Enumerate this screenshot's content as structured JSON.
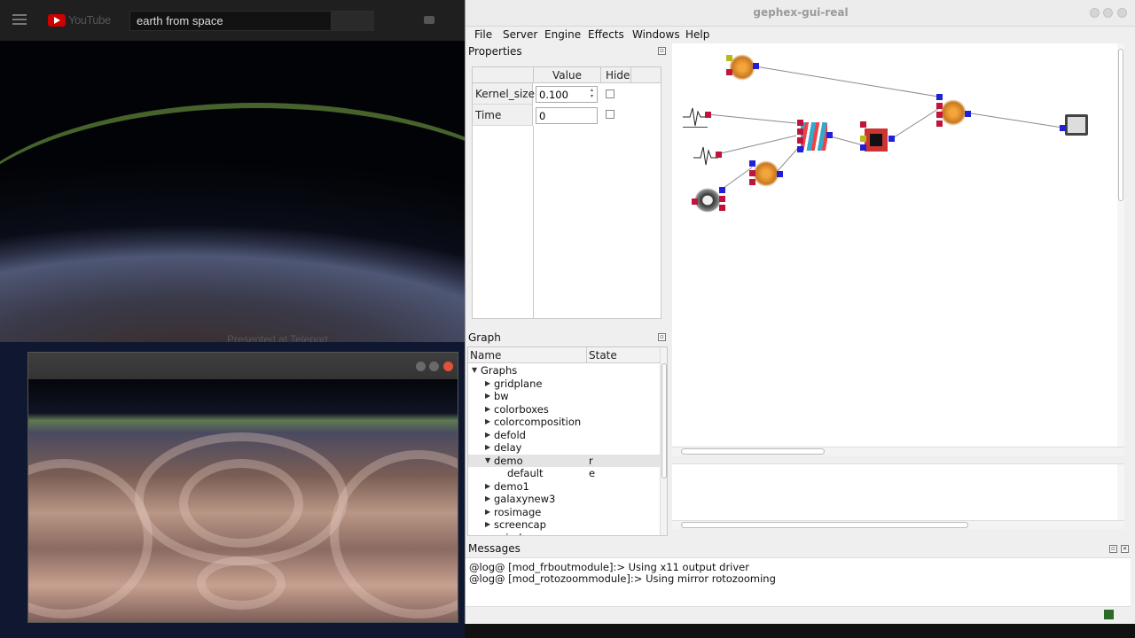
{
  "youtube": {
    "logo_text": "YouTube",
    "search_value": "earth from space",
    "caption": "Presented at Teleport"
  },
  "gephex": {
    "window_title": "gephex-gui-real",
    "menu": [
      "File",
      "Server",
      "Engine",
      "Effects",
      "Windows",
      "Help"
    ],
    "properties": {
      "title": "Properties",
      "col_value": "Value",
      "col_hide": "Hide",
      "rows": [
        {
          "name": "Kernel_size",
          "value": "0.100"
        },
        {
          "name": "Time",
          "value": "0"
        }
      ]
    },
    "graph": {
      "title": "Graph",
      "col_name": "Name",
      "col_state": "State",
      "root": "Graphs",
      "items": [
        {
          "label": "gridplane",
          "state": ""
        },
        {
          "label": "bw",
          "state": ""
        },
        {
          "label": "colorboxes",
          "state": ""
        },
        {
          "label": "colorcomposition",
          "state": ""
        },
        {
          "label": "defold",
          "state": ""
        },
        {
          "label": "delay",
          "state": ""
        },
        {
          "label": "demo",
          "state": "r"
        },
        {
          "label": "default",
          "state": "e"
        },
        {
          "label": "demo1",
          "state": ""
        },
        {
          "label": "galaxynew3",
          "state": ""
        },
        {
          "label": "rosimage",
          "state": ""
        },
        {
          "label": "screencap",
          "state": ""
        },
        {
          "label": "spiral",
          "state": ""
        }
      ]
    },
    "messages": {
      "title": "Messages",
      "lines": [
        "@log@ [mod_frboutmodule]:> Using x11 output driver",
        "@log@ [mod_rotozoommodule]:> Using mirror rotozooming"
      ]
    }
  },
  "colors": {
    "port_in": "#c0143c",
    "port_out": "#2020d8",
    "port_aux": "#b8b818",
    "connection": "#888888"
  }
}
